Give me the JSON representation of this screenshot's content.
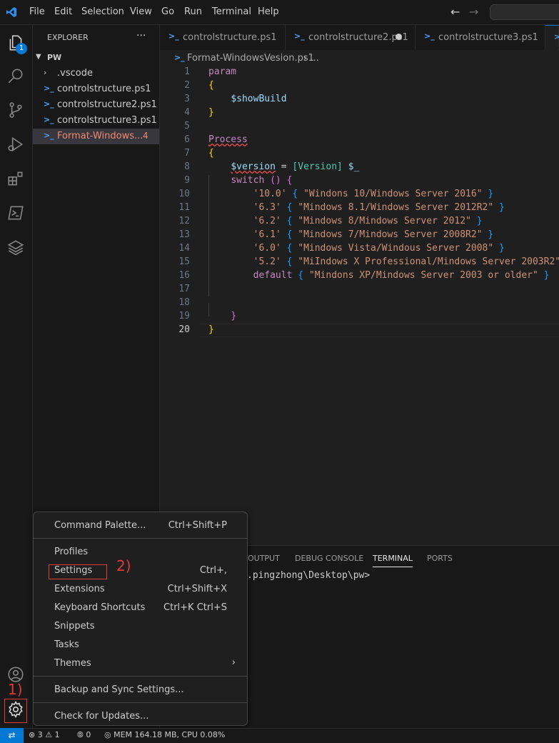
{
  "menubar": {
    "items": [
      "File",
      "Edit",
      "Selection",
      "View",
      "Go",
      "Run",
      "Terminal",
      "Help"
    ]
  },
  "activitybar": {
    "explorer_badge": "1"
  },
  "sidebar": {
    "title": "EXPLORER",
    "more": "···",
    "folder": "PW",
    "items": [
      {
        "name": ".vscode"
      },
      {
        "name": "controlstructure.ps1"
      },
      {
        "name": "controlstructure2.ps1"
      },
      {
        "name": "controlstructure3.ps1"
      },
      {
        "name": "Format-Windows...",
        "problems": "4"
      }
    ]
  },
  "tabs": [
    {
      "label": "controlstructure.ps1"
    },
    {
      "label": "controlstructure2.ps1",
      "dirty": true
    },
    {
      "label": "controlstructure3.ps1"
    }
  ],
  "breadcrumb": {
    "file": "Format-WindowsVesion.ps1",
    "more": "..."
  },
  "editor": {
    "line_numbers": [
      "1",
      "2",
      "3",
      "4",
      "5",
      "6",
      "7",
      "8",
      "9",
      "10",
      "11",
      "12",
      "13",
      "14",
      "15",
      "16",
      "17",
      "18",
      "19",
      "20"
    ],
    "current_line": 20,
    "code": {
      "l1": "param",
      "l2": "{",
      "l3": "$showBuild",
      "l4": "}",
      "l6": "Process",
      "l7": "{",
      "l8_var": "$version",
      "l8_eq": " = ",
      "l8_type": "[Version]",
      "l8_pipe": " $_",
      "l9_kw": "switch",
      "l9_paren": " ()",
      "l9_brace": " {",
      "cases": [
        {
          "key": "'10.0'",
          "value": "\"Windons 10/Windows Server 2016\""
        },
        {
          "key": "'6.3'",
          "value": "\"Mindows 8.1/Windows Server 2012R2\""
        },
        {
          "key": "'6.2'",
          "value": "\"Mindows 8/Mindows Server 2012\""
        },
        {
          "key": "'6.1'",
          "value": "\"Mindows 7/Mindows Server 2008R2\""
        },
        {
          "key": "'6.0'",
          "value": "\"Mindows Vista/Windous Server 2008\""
        },
        {
          "key": "'5.2'",
          "value": "\"MiIndows X Professional/Mindows Server 2003R2\""
        }
      ],
      "default_kw": "default",
      "default_value": "\"Mindons XP/Mindows Server 2003 or older\"",
      "l19": "}",
      "l20": "}"
    }
  },
  "panel": {
    "tabs": [
      "OUTPUT",
      "DEBUG CONSOLE",
      "TERMINAL",
      "PORTS"
    ],
    "active_tab": "TERMINAL",
    "terminal_text": ".pingzhong\\Desktop\\pw>"
  },
  "context_menu": {
    "items": [
      {
        "label": "Command Palette...",
        "shortcut": "Ctrl+Shift+P"
      },
      {
        "label": "Profiles",
        "shortcut": ""
      },
      {
        "label": "Settings",
        "shortcut": "Ctrl+,"
      },
      {
        "label": "Extensions",
        "shortcut": "Ctrl+Shift+X"
      },
      {
        "label": "Keyboard Shortcuts",
        "shortcut": "Ctrl+K Ctrl+S"
      },
      {
        "label": "Snippets",
        "shortcut": ""
      },
      {
        "label": "Tasks",
        "shortcut": ""
      },
      {
        "label": "Themes",
        "shortcut": ""
      },
      {
        "label": "Backup and Sync Settings...",
        "shortcut": ""
      },
      {
        "label": "Check for Updates...",
        "shortcut": ""
      }
    ]
  },
  "annotations": {
    "step1": "1)",
    "step2": "2)"
  },
  "statusbar": {
    "errors": "3",
    "warnings": "1",
    "ports": "0",
    "memory": "MEM 164.18 MB, CPU 0.08%"
  },
  "colors": {
    "accent": "#0078d4",
    "annotation": "#e03a3a",
    "error_file": "#f48771"
  }
}
